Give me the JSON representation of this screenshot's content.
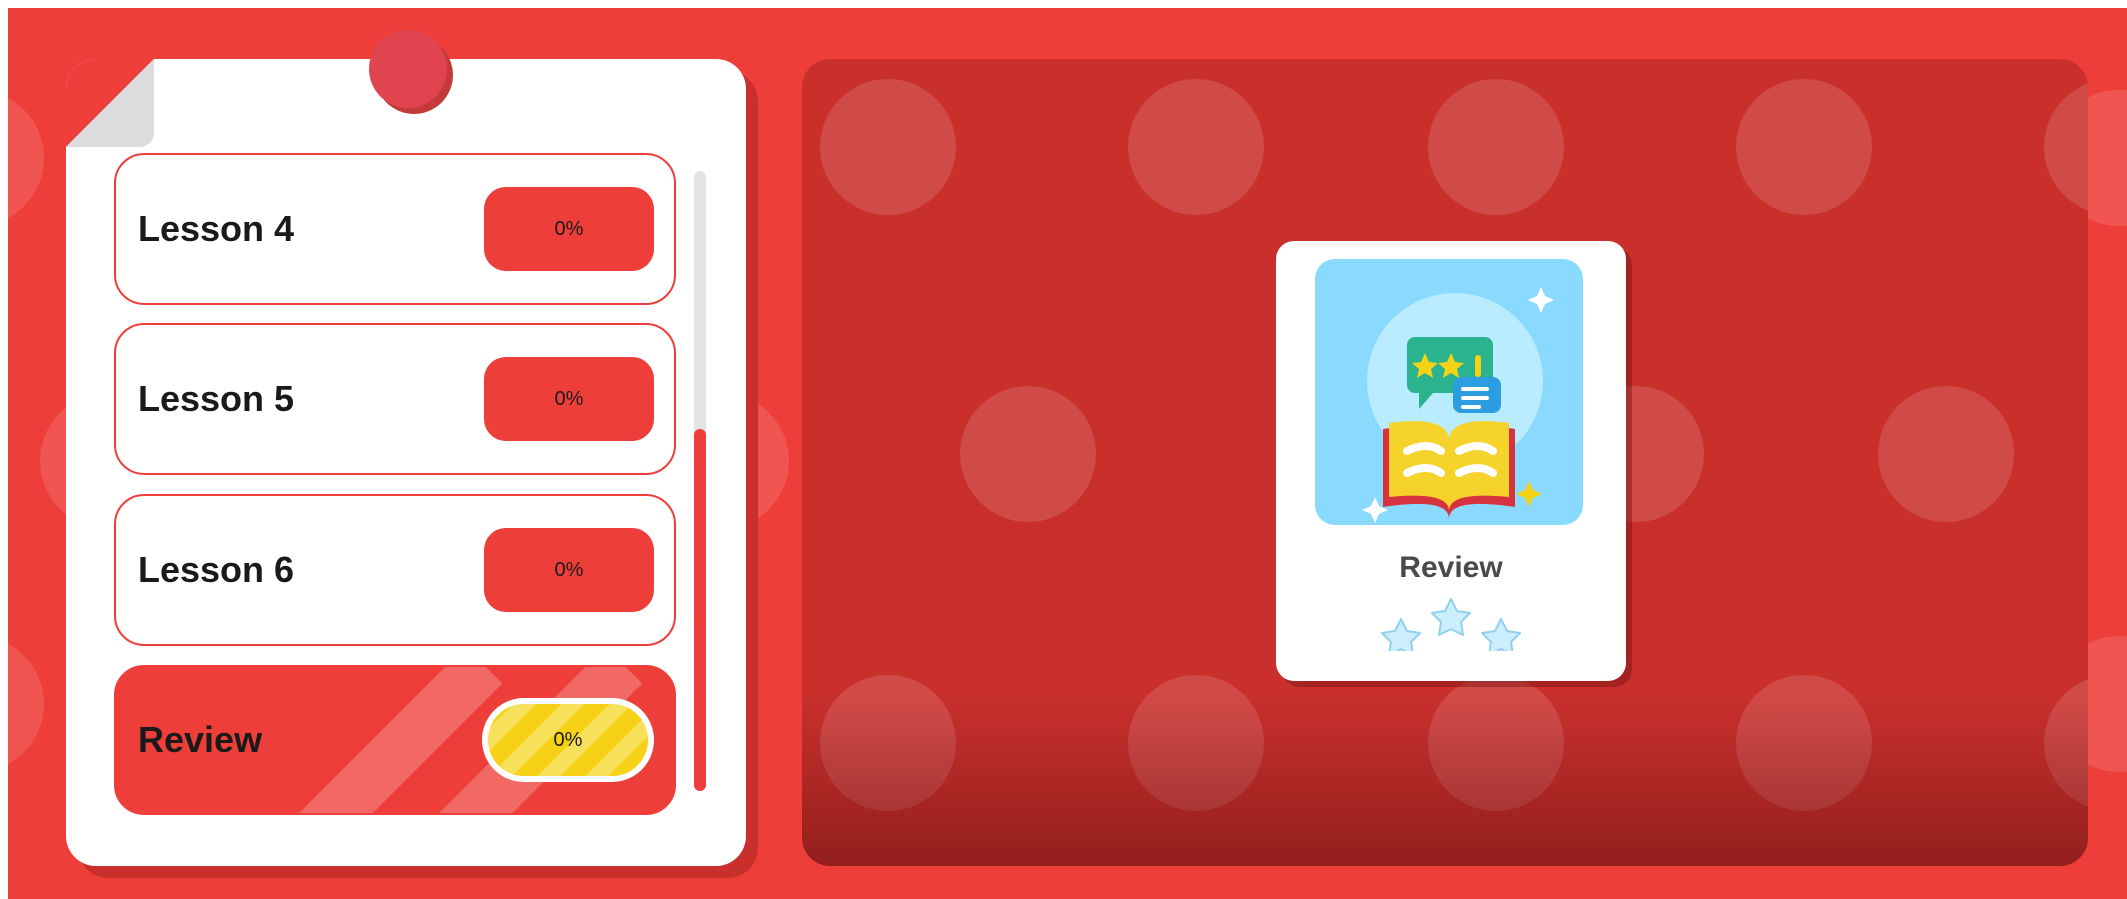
{
  "lessons": [
    {
      "label": "Lesson 4",
      "progress": "0%"
    },
    {
      "label": "Lesson 5",
      "progress": "0%"
    },
    {
      "label": "Lesson 6",
      "progress": "0%"
    },
    {
      "label": "Review",
      "progress": "0%",
      "active": true
    }
  ],
  "review_card": {
    "title": "Review",
    "stars_earned": 0,
    "stars_total": 3,
    "icon": "open-book-review-icon"
  },
  "colors": {
    "primary_red": "#ee3e3a",
    "dark_red": "#c9302c",
    "highlight_yellow": "#f5d215",
    "thumbnail_blue": "#8ad9ff"
  }
}
